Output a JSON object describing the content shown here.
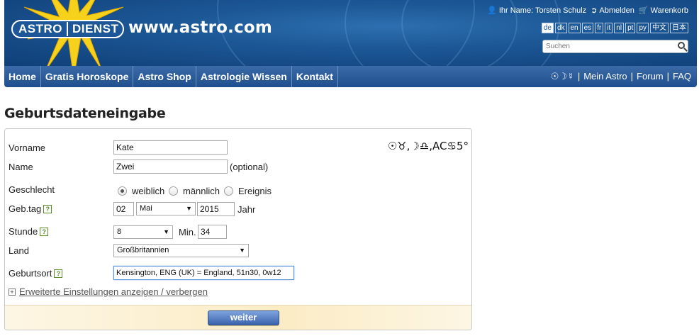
{
  "header": {
    "logo_left": "ASTRO",
    "logo_right": "DIENST",
    "site_url": "www.astro.com",
    "user_label": "Ihr Name: Torsten Schulz",
    "logout_label": "Abmelden",
    "cart_label": "Warenkorb",
    "languages": [
      "de",
      "dk",
      "en",
      "es",
      "fr",
      "it",
      "nl",
      "pt",
      "py",
      "中文",
      "日本"
    ],
    "active_language": "de",
    "search_placeholder": "Suchen"
  },
  "nav": {
    "items": [
      "Home",
      "Gratis Horoskope",
      "Astro Shop",
      "Astrologie Wissen",
      "Kontakt"
    ],
    "right_symbols": "☉☽☿",
    "right_links": [
      "Mein Astro",
      "Forum",
      "FAQ"
    ],
    "separator": "|"
  },
  "page": {
    "title": "Geburtsdateneingabe"
  },
  "form": {
    "chart_signature": "☉♉,☽♎,AC♋5°",
    "vorname_label": "Vorname",
    "vorname_value": "Kate",
    "name_label": "Name",
    "name_value": "Zwei",
    "name_optional": "(optional)",
    "geschlecht_label": "Geschlecht",
    "gender_options": [
      "weiblich",
      "männlich",
      "Ereignis"
    ],
    "gender_selected": "weiblich",
    "gebtag_label": "Geb.tag",
    "day_value": "02",
    "month_value": "Mai",
    "year_value": "2015",
    "year_suffix": "Jahr",
    "stunde_label": "Stunde",
    "hour_value": "8",
    "min_label": "Min.",
    "minute_value": "34",
    "land_label": "Land",
    "land_value": "Großbritannien",
    "geburtsort_label": "Geburtsort",
    "geburtsort_value": "Kensington, ENG (UK) = England, 51n30, 0w12",
    "help_glyph": "?",
    "advanced_toggle_glyph": "+",
    "advanced_link": "Erweiterte Einstellungen anzeigen / verbergen",
    "submit_label": "weiter"
  },
  "colors": {
    "banner": "#1c5795",
    "nav": "#2a5a98",
    "footer_band": "#fbecc5",
    "button": "#4a70b8"
  }
}
